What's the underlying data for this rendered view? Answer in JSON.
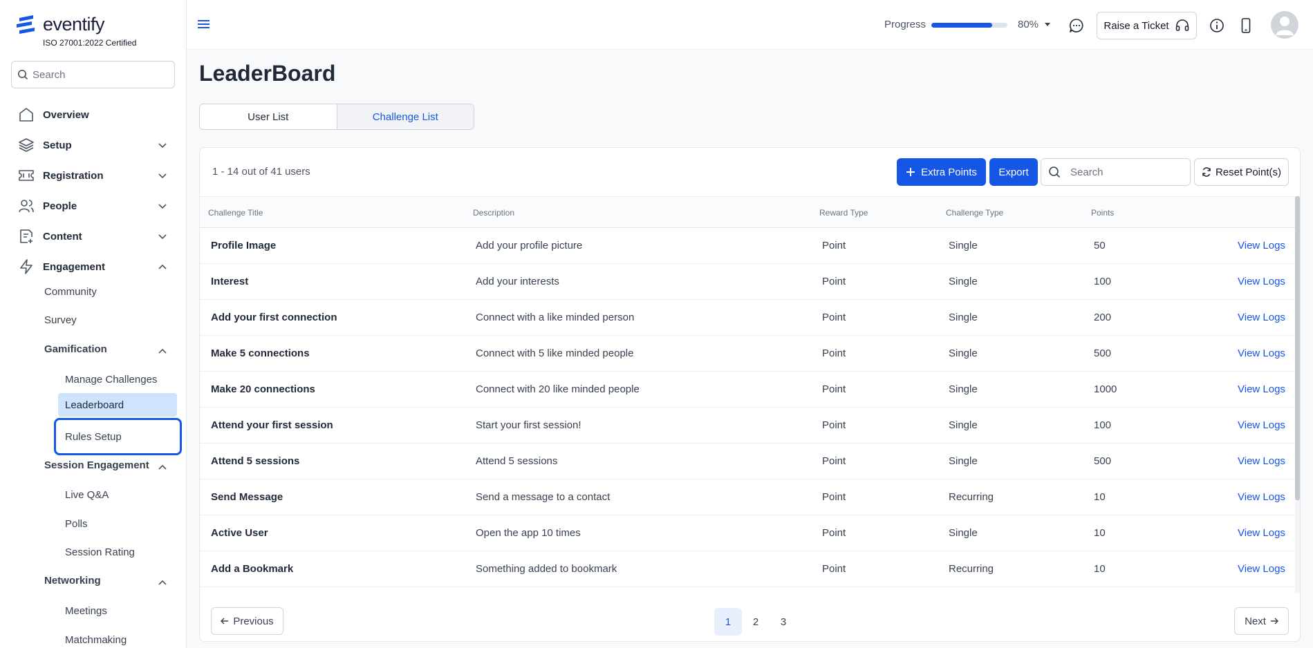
{
  "brand": {
    "name": "eventify",
    "certification": "ISO 27001:2022 Certified"
  },
  "sidebar": {
    "search_placeholder": "Search",
    "nav": [
      {
        "label": "Overview",
        "icon": "home-icon"
      },
      {
        "label": "Setup",
        "icon": "layers-icon"
      },
      {
        "label": "Registration",
        "icon": "ticket-icon"
      },
      {
        "label": "People",
        "icon": "people-icon"
      },
      {
        "label": "Content",
        "icon": "document-plus-icon"
      },
      {
        "label": "Engagement",
        "icon": "lightning-icon"
      }
    ],
    "engagement": {
      "community": "Community",
      "survey": "Survey",
      "gamification": {
        "label": "Gamification",
        "items": [
          "Manage Challenges",
          "Leaderboard",
          "Rules Setup"
        ]
      },
      "session_engagement": {
        "label": "Session Engagement",
        "items": [
          "Live Q&A",
          "Polls",
          "Session Rating"
        ]
      },
      "networking": {
        "label": "Networking",
        "items": [
          "Meetings",
          "Matchmaking"
        ]
      }
    }
  },
  "topbar": {
    "progress_label": "Progress",
    "progress_value": "80%",
    "progress_fraction": 0.8,
    "raise_ticket": "Raise a Ticket"
  },
  "main": {
    "title": "LeaderBoard",
    "tabs": [
      "User List",
      "Challenge List"
    ],
    "count_text": "1 - 14 out of 41 users",
    "extra_points": "Extra Points",
    "export": "Export",
    "search_placeholder": "Search",
    "reset": "Reset Point(s)",
    "columns": [
      "Challenge Title",
      "Description",
      "Reward Type",
      "Challenge Type",
      "Points"
    ],
    "action_label": "View Logs",
    "rows": [
      [
        "Profile Image",
        "Add your profile picture",
        "Point",
        "Single",
        "50"
      ],
      [
        "Interest",
        "Add your interests",
        "Point",
        "Single",
        "100"
      ],
      [
        "Add your first connection",
        "Connect with a like minded person",
        "Point",
        "Single",
        "200"
      ],
      [
        "Make 5 connections",
        "Connect with 5 like minded people",
        "Point",
        "Single",
        "500"
      ],
      [
        "Make 20 connections",
        "Connect with 20 like minded people",
        "Point",
        "Single",
        "1000"
      ],
      [
        "Attend your first session",
        "Start your first session!",
        "Point",
        "Single",
        "100"
      ],
      [
        "Attend 5 sessions",
        "Attend 5 sessions",
        "Point",
        "Single",
        "500"
      ],
      [
        "Send Message",
        "Send a message to a contact",
        "Point",
        "Recurring",
        "10"
      ],
      [
        "Active User",
        "Open the app 10 times",
        "Point",
        "Single",
        "10"
      ],
      [
        "Add a Bookmark",
        "Something added to bookmark",
        "Point",
        "Recurring",
        "10"
      ]
    ],
    "pagination": {
      "previous": "Previous",
      "next": "Next",
      "pages": [
        "1",
        "2",
        "3"
      ],
      "current": "1"
    }
  },
  "colors": {
    "accent": "#1656e6",
    "active_nav_bg": "#cfe3ff"
  }
}
